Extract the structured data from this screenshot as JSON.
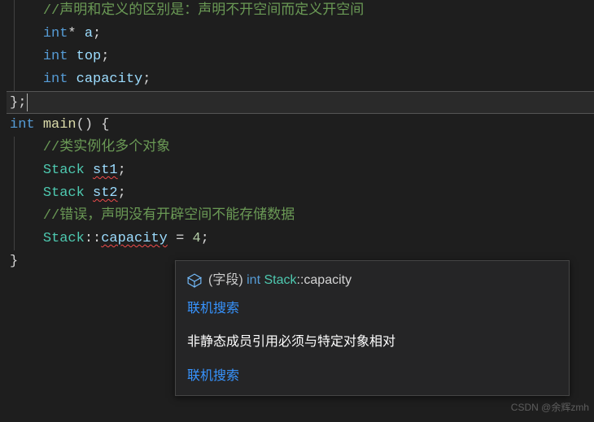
{
  "code": {
    "line1": {
      "comment": "//声明和定义的区别是：声明不开空间而定义开空间"
    },
    "line2": {
      "type": "int",
      "ptr": "*",
      "var": "a",
      "semi": ";"
    },
    "line3": {
      "type": "int",
      "var": "top",
      "semi": ";"
    },
    "line4": {
      "type": "int",
      "var": "capacity",
      "semi": ";"
    },
    "line5": {
      "brace": "};"
    },
    "line6": {
      "type": "int",
      "fn": "main",
      "parens": "()",
      "space": " ",
      "brace": "{"
    },
    "line7": {
      "comment": "//类实例化多个对象"
    },
    "line8": {
      "type": "Stack",
      "var": "st1",
      "semi": ";"
    },
    "line9": {
      "type": "Stack",
      "var": "st2",
      "semi": ";"
    },
    "line10": {
      "comment": "//错误，声明没有开辟空间不能存储数据"
    },
    "line11": {
      "type": "Stack",
      "scope": "::",
      "member": "capacity",
      "space": " ",
      "op": "=",
      "space2": " ",
      "num": "4",
      "semi": ";"
    },
    "line12": {
      "brace": "}"
    }
  },
  "tooltip": {
    "sig_label": "(字段)",
    "sig_type": "int",
    "sig_class": "Stack",
    "sig_member": "capacity",
    "sig_scope": "::",
    "link1": "联机搜索",
    "error": "非静态成员引用必须与特定对象相对",
    "link2": "联机搜索"
  },
  "watermark": "CSDN @余辉zmh"
}
